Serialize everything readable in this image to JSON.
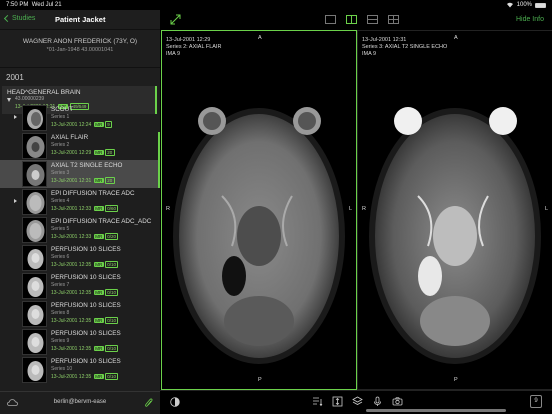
{
  "status_bar": {
    "time": "7:50 PM",
    "date": "Wed Jul 21",
    "battery": "100%"
  },
  "sidebar": {
    "back_label": "Studies",
    "title": "Patient Jacket",
    "patient_name": "WAGNER ANON FREDERICK (73Y, O)",
    "patient_dob": "*01-Jan-1948  43.00001041",
    "year": "2001",
    "study": {
      "title": "HEAD^GENERAL BRAIN",
      "id": "43.00000239",
      "date": "13-Jul-2001 12:21",
      "modality": "MR",
      "count": "49/549"
    },
    "series": [
      {
        "name": "SCOUT",
        "number": "Series 1",
        "date": "13-Jul-2001 12:24",
        "modality": "MR",
        "count": "9",
        "expandable": true,
        "type": "scout"
      },
      {
        "name": "AXIAL FLAIR",
        "number": "Series 2",
        "date": "13-Jul-2001 12:29",
        "modality": "MR",
        "count": "20",
        "expandable": false,
        "type": "flair"
      },
      {
        "name": "AXIAL T2 SINGLE ECHO",
        "number": "Series 3",
        "date": "13-Jul-2001 12:31",
        "modality": "MR",
        "count": "20",
        "expandable": false,
        "type": "t2"
      },
      {
        "name": "EPI DIFFUSION TRACE ADC",
        "number": "Series 4",
        "date": "13-Jul-2001 12:33",
        "modality": "MR",
        "count": "0/60",
        "expandable": true,
        "type": "dwi"
      },
      {
        "name": "EPI DIFFUSION TRACE ADC_ADC",
        "number": "Series 5",
        "date": "13-Jul-2001 12:33",
        "modality": "MR",
        "count": "0/20",
        "expandable": false,
        "type": "dwi"
      },
      {
        "name": "PERFUSION 10 SLICES",
        "number": "Series 6",
        "date": "13-Jul-2001 12:35",
        "modality": "MR",
        "count": "0/10",
        "expandable": false,
        "type": "perf"
      },
      {
        "name": "PERFUSION 10 SLICES",
        "number": "Series 7",
        "date": "13-Jul-2001 12:35",
        "modality": "MR",
        "count": "0/10",
        "expandable": false,
        "type": "perf"
      },
      {
        "name": "PERFUSION 10 SLICES",
        "number": "Series 8",
        "date": "13-Jul-2001 12:35",
        "modality": "MR",
        "count": "0/10",
        "expandable": false,
        "type": "perf"
      },
      {
        "name": "PERFUSION 10 SLICES",
        "number": "Series 9",
        "date": "13-Jul-2001 12:35",
        "modality": "MR",
        "count": "0/10",
        "expandable": false,
        "type": "perf"
      },
      {
        "name": "PERFUSION 10 SLICES",
        "number": "Series 10",
        "date": "13-Jul-2001 12:35",
        "modality": "MR",
        "count": "0/10",
        "expandable": false,
        "type": "perf"
      }
    ],
    "user": "berlin@bervm-ease"
  },
  "toolbar": {
    "hide_info_label": "Hide Info"
  },
  "viewports": [
    {
      "datetime": "13-Jul-2001 12:29",
      "series": "Series 2: AXIAL FLAIR",
      "image": "IMA 9",
      "top": "A",
      "bottom": "P",
      "left": "R",
      "right": "L"
    },
    {
      "datetime": "13-Jul-2001 12:31",
      "series": "Series 3: AXIAL T2 SINGLE ECHO",
      "image": "IMA 9",
      "top": "A",
      "bottom": "P",
      "left": "R",
      "right": "L"
    }
  ],
  "bottom": {
    "page_count": "9"
  },
  "colors": {
    "accent": "#6bd14a",
    "sidebar_bg": "#1e1e1e",
    "selected_bg": "#4a4a4a"
  }
}
